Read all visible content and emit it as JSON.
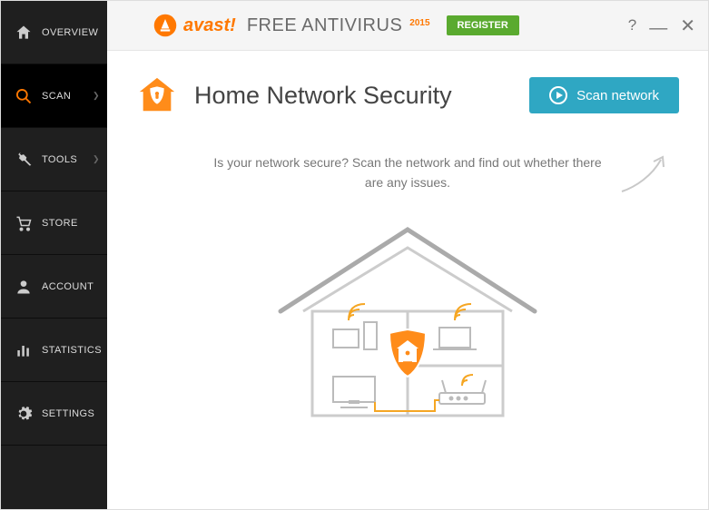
{
  "sidebar": {
    "items": [
      {
        "label": "OVERVIEW"
      },
      {
        "label": "SCAN"
      },
      {
        "label": "TOOLS"
      },
      {
        "label": "STORE"
      },
      {
        "label": "ACCOUNT"
      },
      {
        "label": "STATISTICS"
      },
      {
        "label": "SETTINGS"
      }
    ]
  },
  "topbar": {
    "brand_name": "avast!",
    "brand_sub": "FREE ANTIVIRUS",
    "brand_year": "2015",
    "register_label": "REGISTER"
  },
  "page": {
    "title": "Home Network Security",
    "scan_button": "Scan network",
    "intro": "Is your network secure? Scan the network and find out whether there are any issues."
  },
  "colors": {
    "accent_orange": "#ff7800",
    "accent_teal": "#2fa7c3",
    "accent_green": "#5aaa2f"
  }
}
